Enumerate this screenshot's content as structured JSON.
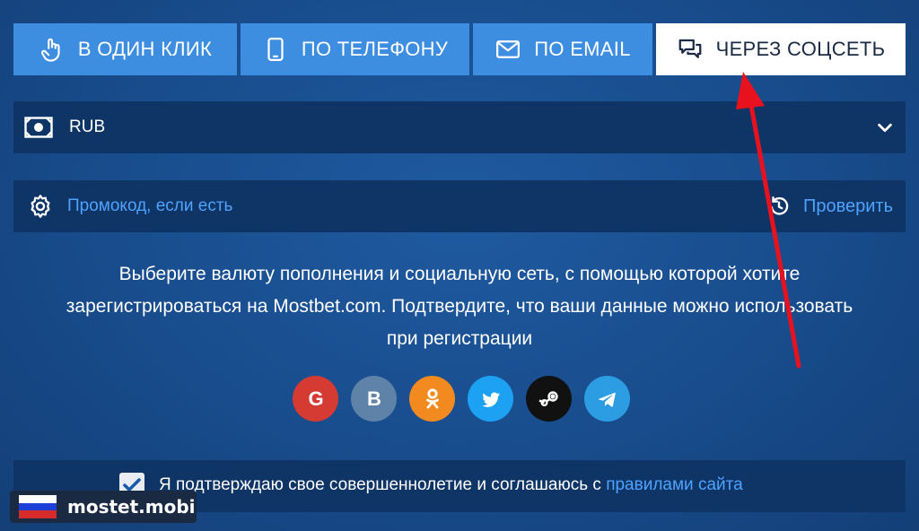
{
  "tabs": [
    {
      "label": "В ОДИН КЛИК",
      "icon": "pointer-hand-icon"
    },
    {
      "label": "ПО ТЕЛЕФОНУ",
      "icon": "phone-icon"
    },
    {
      "label": "ПО EMAIL",
      "icon": "envelope-icon"
    },
    {
      "label": "ЧЕРЕЗ СОЦСЕТЬ",
      "icon": "chat-bubbles-icon",
      "active": true
    }
  ],
  "currency": {
    "selected": "RUB",
    "icon": "cash-icon"
  },
  "promo": {
    "placeholder": "Промокод, если есть",
    "check_label": "Проверить"
  },
  "description": "Выберите валюту пополнения и социальную сеть, с помощью которой хотите зарегистрироваться на Mostbet.com. Подтвердите, что ваши данные можно использовать при регистрации",
  "socials": [
    {
      "name": "google",
      "color": "#d53a33",
      "glyph": "G"
    },
    {
      "name": "vk",
      "color": "#5e82a8",
      "glyph": "B"
    },
    {
      "name": "odnoklassniki",
      "color": "#f28a1f"
    },
    {
      "name": "twitter",
      "color": "#1da1f2"
    },
    {
      "name": "steam",
      "color": "#111111"
    },
    {
      "name": "telegram",
      "color": "#2d9de3"
    }
  ],
  "agreement": {
    "text": "Я подтверждаю свое совершеннолетие и соглашаюсь с ",
    "link": "правилами сайта",
    "checked": true
  },
  "watermark": {
    "text": "mostet.mobi"
  },
  "colors": {
    "accent": "#3d8de0",
    "panel": "#0f3566",
    "link": "#4ea3ff",
    "arrow": "#e8121e"
  }
}
